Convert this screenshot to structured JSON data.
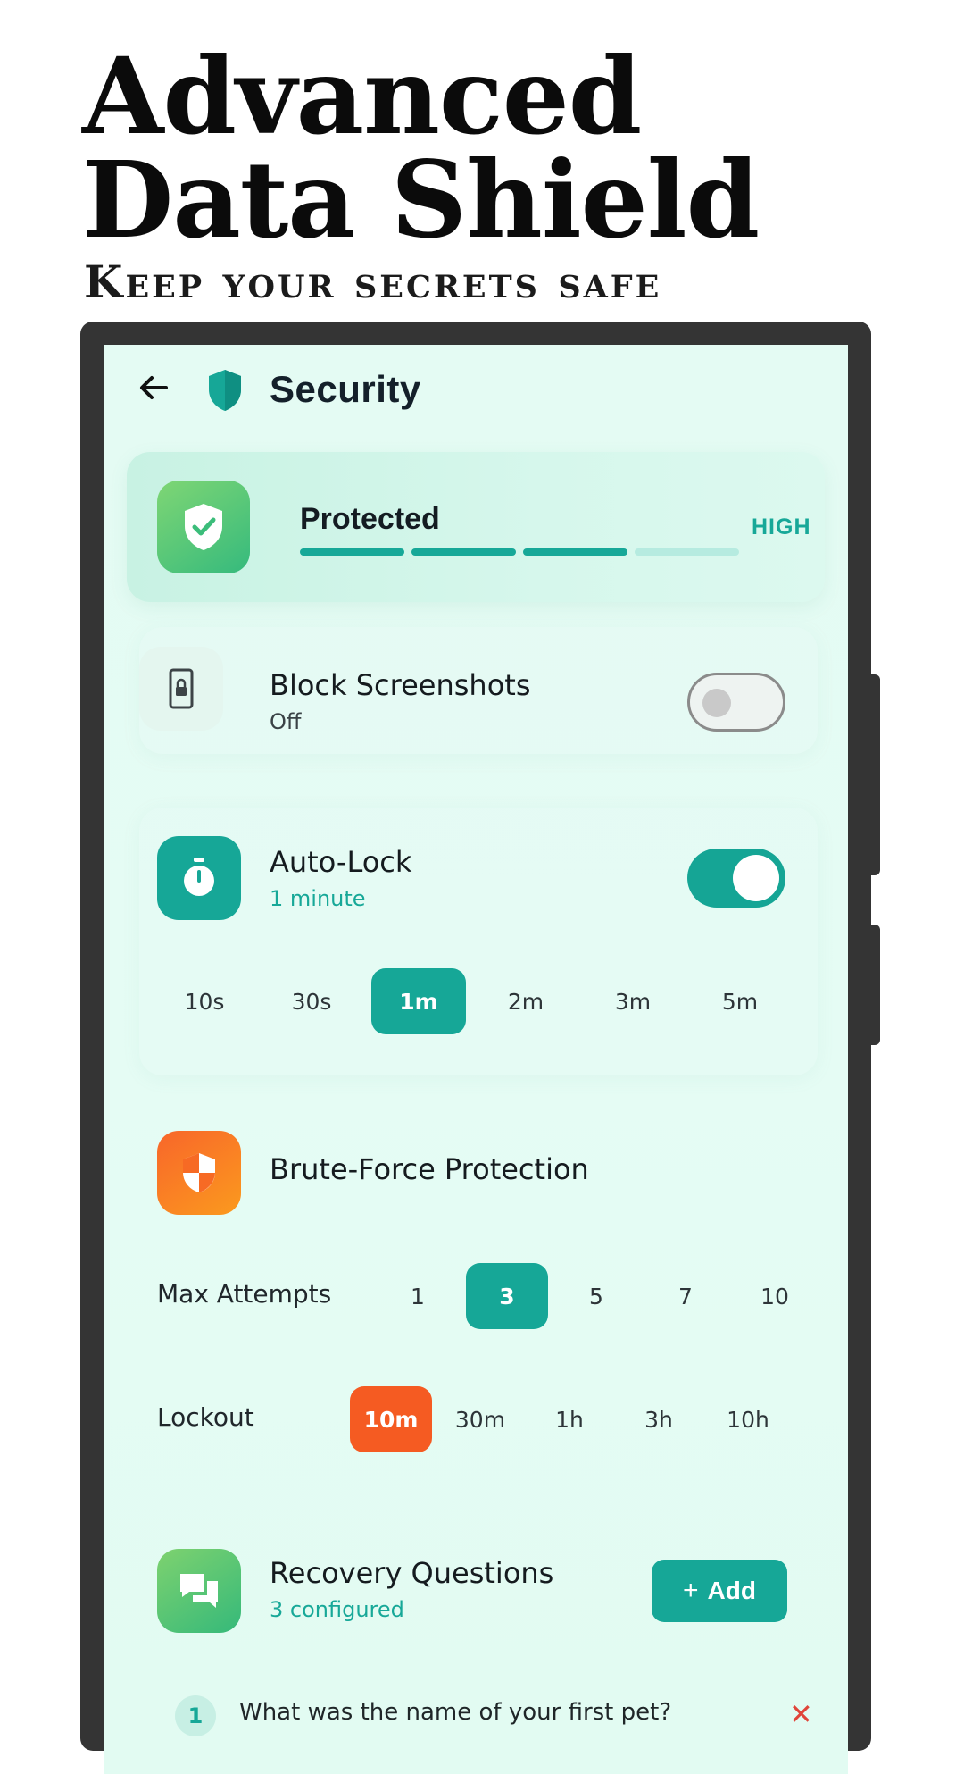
{
  "headline": {
    "line1": "Advanced",
    "line2": "Data Shield",
    "tagline": "Keep your secrets safe"
  },
  "topbar": {
    "back_icon": "arrow-left-icon",
    "logo_icon": "shield-icon",
    "title": "Security"
  },
  "status": {
    "icon": "shield-check-icon",
    "title": "Protected",
    "level": "HIGH",
    "segments_total": 4,
    "segments_filled": 3,
    "colors": {
      "accent": "#17a898",
      "track": "#b6ebe0"
    }
  },
  "block_screenshots": {
    "icon": "phone-lock-icon",
    "title": "Block Screenshots",
    "status": "Off",
    "enabled": false
  },
  "auto_lock": {
    "icon": "timer-icon",
    "title": "Auto-Lock",
    "status": "1 minute",
    "enabled": true,
    "options": [
      "10s",
      "30s",
      "1m",
      "2m",
      "3m",
      "5m"
    ],
    "selected": "1m"
  },
  "brute_force": {
    "icon": "shield-half-icon",
    "title": "Brute-Force Protection",
    "max_attempts_label": "Max Attempts",
    "max_attempts_options": [
      "1",
      "3",
      "5",
      "7",
      "10"
    ],
    "max_attempts_selected": "3",
    "lockout_label": "Lockout",
    "lockout_options": [
      "10m",
      "30m",
      "1h",
      "3h",
      "10h"
    ],
    "lockout_selected": "10m"
  },
  "recovery": {
    "icon": "chat-bubbles-icon",
    "title": "Recovery Questions",
    "status": "3 configured",
    "add_label": "Add",
    "questions": [
      {
        "number": "1",
        "text": "What was the name of your first pet?"
      }
    ]
  },
  "colors": {
    "teal": "#16a797",
    "orange": "#f55b22",
    "screen_bg": "#e4fbf3",
    "frame": "#343434"
  }
}
